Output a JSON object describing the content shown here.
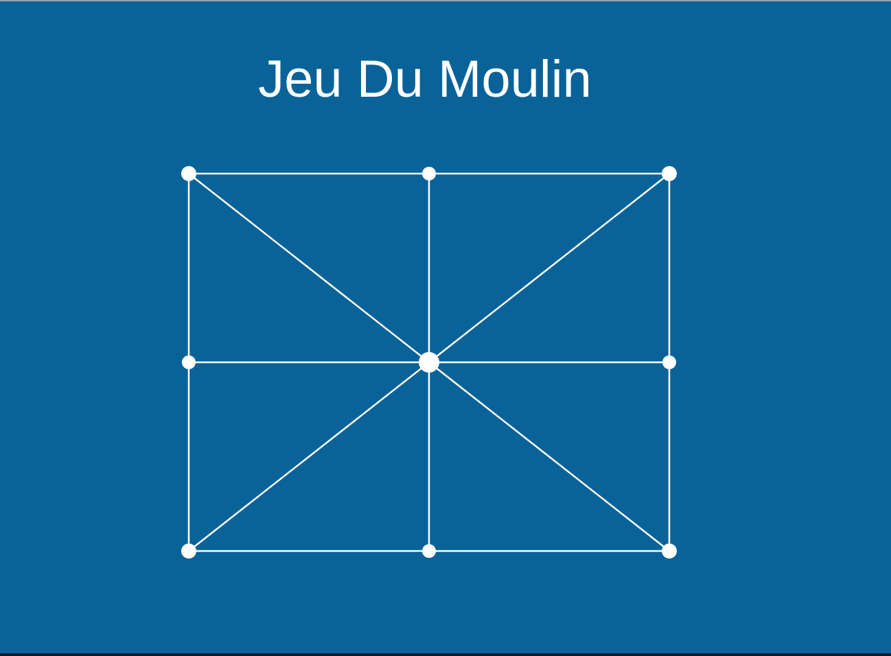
{
  "game": {
    "title": "Jeu Du Moulin",
    "colors": {
      "background": "#0a6398",
      "lines": "#ffffff",
      "points": "#ffffff"
    }
  }
}
